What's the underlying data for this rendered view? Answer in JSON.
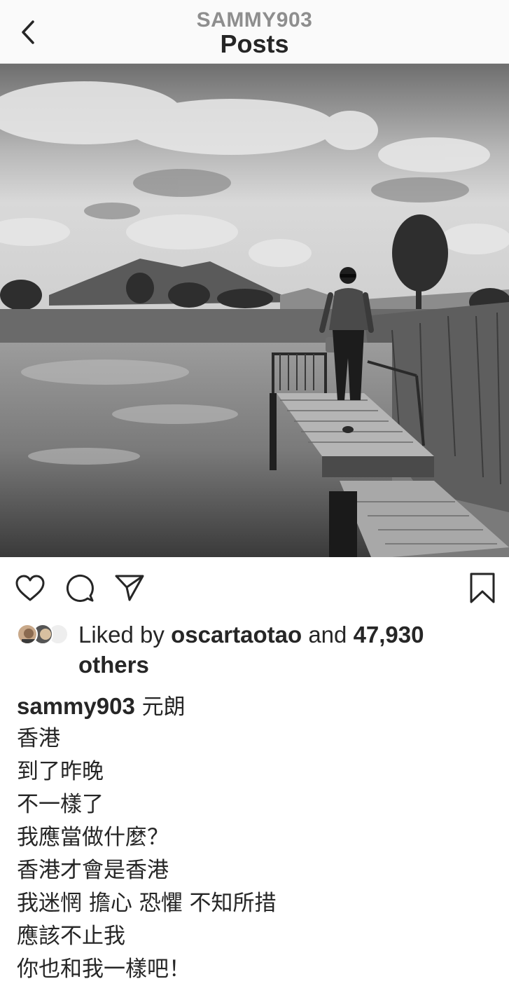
{
  "header": {
    "username": "SAMMY903",
    "title": "Posts"
  },
  "icons": {
    "back": "chevron-left-icon",
    "like": "heart-icon",
    "comment": "comment-icon",
    "share": "paper-plane-icon",
    "save": "bookmark-icon"
  },
  "likes": {
    "prefix": "Liked by",
    "user": "oscartaotao",
    "and": "and",
    "count": "47,930",
    "suffix": "others"
  },
  "caption": {
    "username": "sammy903",
    "first_line": "元朗",
    "lines": [
      "香港",
      "到了昨晚",
      "不一樣了",
      "我應當做什麼？",
      "香港才會是香港",
      "我迷惘 擔心 恐懼 不知所措",
      "應該不止我",
      "你也和我一樣吧！"
    ]
  }
}
